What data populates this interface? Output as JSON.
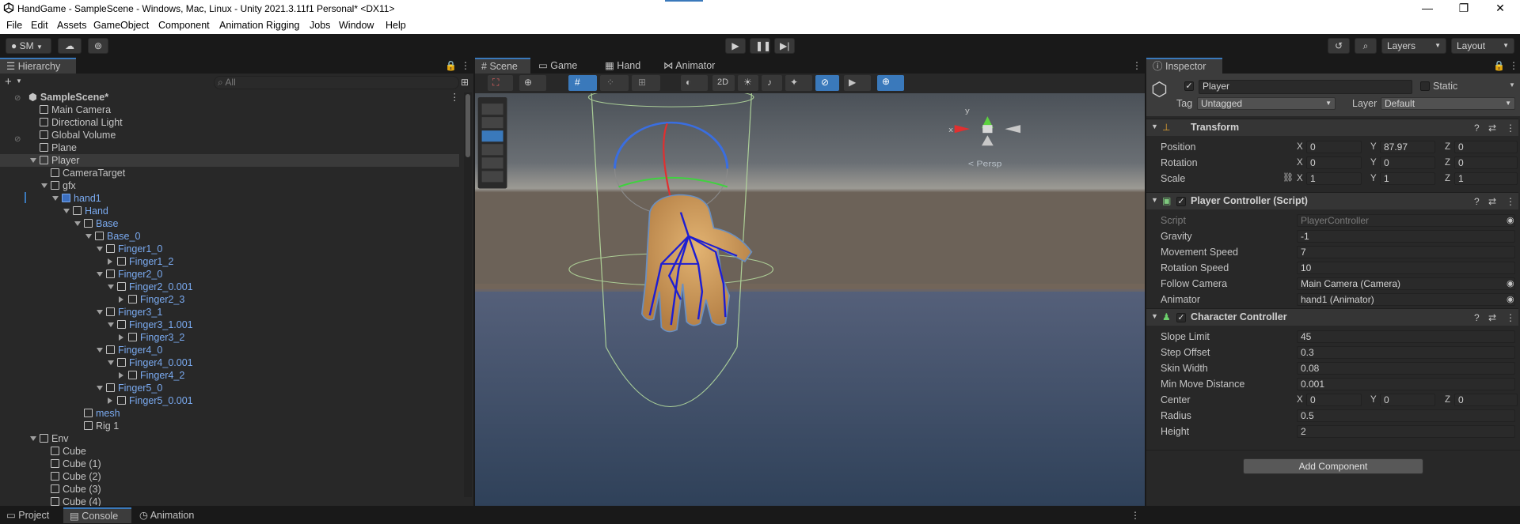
{
  "window": {
    "title": "HandGame - SampleScene - Windows, Mac, Linux - Unity 2021.3.11f1 Personal* <DX11>",
    "minimize": "—",
    "maximize": "❐",
    "close": "✕"
  },
  "menu": [
    "File",
    "Edit",
    "Assets",
    "GameObject",
    "Component",
    "Animation Rigging",
    "Jobs",
    "Window",
    "Help"
  ],
  "toolbar": {
    "account": "SM",
    "layers": "Layers",
    "layout": "Layout"
  },
  "hierarchy": {
    "tab": "Hierarchy",
    "search_placeholder": "All",
    "rows": [
      {
        "label": "SampleScene*",
        "indent": 0,
        "kind": "scene",
        "bold": true
      },
      {
        "label": "Main Camera",
        "indent": 1,
        "kind": "cube"
      },
      {
        "label": "Directional Light",
        "indent": 1,
        "kind": "cube"
      },
      {
        "label": "Global Volume",
        "indent": 1,
        "kind": "cube"
      },
      {
        "label": "Plane",
        "indent": 1,
        "kind": "cube"
      },
      {
        "label": "Player",
        "indent": 1,
        "kind": "cube",
        "expanded": true,
        "selected": true
      },
      {
        "label": "CameraTarget",
        "indent": 2,
        "kind": "cube"
      },
      {
        "label": "gfx",
        "indent": 2,
        "kind": "cube",
        "expanded": true
      },
      {
        "label": "hand1",
        "indent": 3,
        "kind": "prefab",
        "expanded": true,
        "blue": true
      },
      {
        "label": "Hand",
        "indent": 4,
        "kind": "cube",
        "expanded": true,
        "blue": true
      },
      {
        "label": "Base",
        "indent": 5,
        "kind": "cube",
        "expanded": true,
        "blue": true
      },
      {
        "label": "Base_0",
        "indent": 6,
        "kind": "cube",
        "expanded": true,
        "blue": true
      },
      {
        "label": "Finger1_0",
        "indent": 7,
        "kind": "cube",
        "expanded": true,
        "blue": true
      },
      {
        "label": "Finger1_2",
        "indent": 8,
        "kind": "cube",
        "collapsed": true,
        "blue": true
      },
      {
        "label": "Finger2_0",
        "indent": 7,
        "kind": "cube",
        "expanded": true,
        "blue": true
      },
      {
        "label": "Finger2_0.001",
        "indent": 8,
        "kind": "cube",
        "expanded": true,
        "blue": true
      },
      {
        "label": "Finger2_3",
        "indent": 9,
        "kind": "cube",
        "collapsed": true,
        "blue": true
      },
      {
        "label": "Finger3_1",
        "indent": 7,
        "kind": "cube",
        "expanded": true,
        "blue": true
      },
      {
        "label": "Finger3_1.001",
        "indent": 8,
        "kind": "cube",
        "expanded": true,
        "blue": true
      },
      {
        "label": "Finger3_2",
        "indent": 9,
        "kind": "cube",
        "collapsed": true,
        "blue": true
      },
      {
        "label": "Finger4_0",
        "indent": 7,
        "kind": "cube",
        "expanded": true,
        "blue": true
      },
      {
        "label": "Finger4_0.001",
        "indent": 8,
        "kind": "cube",
        "expanded": true,
        "blue": true
      },
      {
        "label": "Finger4_2",
        "indent": 9,
        "kind": "cube",
        "collapsed": true,
        "blue": true
      },
      {
        "label": "Finger5_0",
        "indent": 7,
        "kind": "cube",
        "expanded": true,
        "blue": true
      },
      {
        "label": "Finger5_0.001",
        "indent": 8,
        "kind": "cube",
        "collapsed": true,
        "blue": true
      },
      {
        "label": "mesh",
        "indent": 5,
        "kind": "cube",
        "blue": true
      },
      {
        "label": "Rig 1",
        "indent": 5,
        "kind": "cube"
      },
      {
        "label": "Env",
        "indent": 1,
        "kind": "cube",
        "expanded": true
      },
      {
        "label": "Cube",
        "indent": 2,
        "kind": "cube"
      },
      {
        "label": "Cube (1)",
        "indent": 2,
        "kind": "cube"
      },
      {
        "label": "Cube (2)",
        "indent": 2,
        "kind": "cube"
      },
      {
        "label": "Cube (3)",
        "indent": 2,
        "kind": "cube"
      },
      {
        "label": "Cube (4)",
        "indent": 2,
        "kind": "cube"
      }
    ]
  },
  "scene": {
    "tabs": [
      "Scene",
      "Game",
      "Hand",
      "Animator"
    ],
    "mode_2d": "2D",
    "persp": "< Persp",
    "gizmo_x": "x",
    "gizmo_y": "y"
  },
  "inspector": {
    "tab": "Inspector",
    "object_name": "Player",
    "static_label": "Static",
    "tag_label": "Tag",
    "tag_value": "Untagged",
    "layer_label": "Layer",
    "layer_value": "Default",
    "transform": {
      "title": "Transform",
      "position": {
        "label": "Position",
        "x": "0",
        "y": "87.97",
        "z": "0"
      },
      "rotation": {
        "label": "Rotation",
        "x": "0",
        "y": "0",
        "z": "0"
      },
      "scale": {
        "label": "Scale",
        "x": "1",
        "y": "1",
        "z": "1"
      }
    },
    "player_controller": {
      "title": "Player Controller (Script)",
      "fields": [
        {
          "label": "Script",
          "value": "PlayerController",
          "dim": true
        },
        {
          "label": "Gravity",
          "value": "-1"
        },
        {
          "label": "Movement Speed",
          "value": "7"
        },
        {
          "label": "Rotation Speed",
          "value": "10"
        },
        {
          "label": "Follow Camera",
          "value": "Main Camera (Camera)"
        },
        {
          "label": "Animator",
          "value": "hand1 (Animator)"
        }
      ]
    },
    "character_controller": {
      "title": "Character Controller",
      "fields": [
        {
          "label": "Slope Limit",
          "value": "45"
        },
        {
          "label": "Step Offset",
          "value": "0.3"
        },
        {
          "label": "Skin Width",
          "value": "0.08"
        },
        {
          "label": "Min Move Distance",
          "value": "0.001"
        }
      ],
      "center": {
        "label": "Center",
        "x": "0",
        "y": "0",
        "z": "0"
      },
      "fields2": [
        {
          "label": "Radius",
          "value": "0.5"
        },
        {
          "label": "Height",
          "value": "2"
        }
      ]
    },
    "add_component": "Add Component",
    "axis_x": "X",
    "axis_y": "Y",
    "axis_z": "Z"
  },
  "bottom_tabs": [
    "Project",
    "Console",
    "Animation"
  ]
}
